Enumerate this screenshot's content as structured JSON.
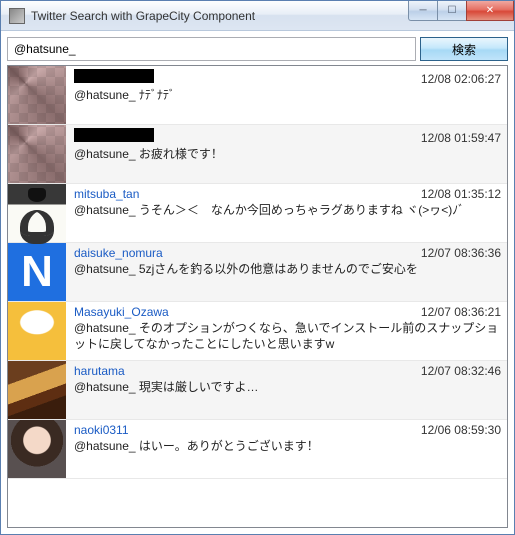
{
  "window": {
    "title": "Twitter Search with GrapeCity Component"
  },
  "search": {
    "value": "@hatsune_",
    "button_label": "検索"
  },
  "tweets": [
    {
      "username": "",
      "redacted": true,
      "timestamp": "12/08 02:06:27",
      "text": "@hatsune_ ﾅﾃﾞﾅﾃﾞ",
      "avatar": "pixel"
    },
    {
      "username": "",
      "redacted": true,
      "timestamp": "12/08 01:59:47",
      "text": "@hatsune_ お疲れ様です！",
      "avatar": "pixel"
    },
    {
      "username": "mitsuba_tan",
      "redacted": false,
      "timestamp": "12/08 01:35:12",
      "text": "@hatsune_ うそん＞＜　なんか今回めっちゃラグありますね ヾ(>ヮ<)ﾉﾞ",
      "avatar": "mitsuba"
    },
    {
      "username": "daisuke_nomura",
      "redacted": false,
      "timestamp": "12/07 08:36:36",
      "text": "@hatsune_ 5zjさんを釣る以外の他意はありませんのでご安心を",
      "avatar": "n"
    },
    {
      "username": "Masayuki_Ozawa",
      "redacted": false,
      "timestamp": "12/07 08:36:21",
      "text": "@hatsune_ そのオプションがつくなら、急いでインストール前のスナップショットに戻してなかったことにしたいと思いますw",
      "avatar": "egg"
    },
    {
      "username": "harutama",
      "redacted": false,
      "timestamp": "12/07 08:32:46",
      "text": "@hatsune_ 現実は厳しいですよ…",
      "avatar": "bread"
    },
    {
      "username": "naoki0311",
      "redacted": false,
      "timestamp": "12/06 08:59:30",
      "text": "@hatsune_ はいー。ありがとうございます！",
      "avatar": "naoki"
    }
  ]
}
